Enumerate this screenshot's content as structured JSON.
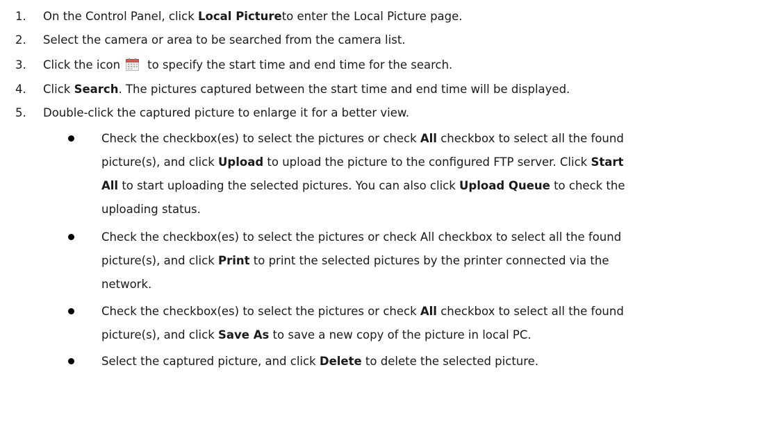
{
  "steps": [
    {
      "num": "1.",
      "pre": "On the Control Panel, click ",
      "bold": "Local Picture",
      "post": " to enter the Local Picture page."
    },
    {
      "num": "2.",
      "text": "Select the camera or area to be searched from the camera list."
    },
    {
      "num": "3.",
      "pre": "Click the icon",
      "post": "to specify the start time and end time for the search.",
      "icon": "calendar-icon"
    },
    {
      "num": "4.",
      "pre": "Click ",
      "bold": "Search",
      "post": ". The pictures captured between the start time and end time will be displayed."
    },
    {
      "num": "5.",
      "text": "Double-click the captured picture to enlarge it for a better view."
    }
  ],
  "bullets": [
    {
      "lines": [
        [
          {
            "t": "Check the checkbox(es) to select the pictures or check "
          },
          {
            "b": "All"
          },
          {
            "t": " checkbox to select all the found"
          }
        ],
        [
          {
            "t": "picture(s), and click "
          },
          {
            "b": "Upload"
          },
          {
            "t": " to upload the picture to the configured FTP server. Click "
          },
          {
            "b": "Start"
          }
        ],
        [
          {
            "b": "All"
          },
          {
            "t": " to start uploading the selected pictures. You can also click "
          },
          {
            "b": "Upload Queue"
          },
          {
            "t": " to check the"
          }
        ],
        [
          {
            "t": "uploading status."
          }
        ]
      ]
    },
    {
      "lines": [
        [
          {
            "t": "Check the checkbox(es) to select the pictures or check All checkbox to select all the found"
          }
        ],
        [
          {
            "t": "picture(s), and click "
          },
          {
            "b": "Print"
          },
          {
            "t": " to print the selected pictures by the printer connected via the"
          }
        ],
        [
          {
            "t": "network."
          }
        ]
      ]
    },
    {
      "lines": [
        [
          {
            "t": "Check the checkbox(es) to select the pictures or check "
          },
          {
            "b": "All"
          },
          {
            "t": " checkbox to select all the found"
          }
        ],
        [
          {
            "t": "picture(s), and click "
          },
          {
            "b": "Save As"
          },
          {
            "t": " to save a new copy of the picture in local PC."
          }
        ]
      ]
    },
    {
      "lines": [
        [
          {
            "t": "Select the captured picture, and click "
          },
          {
            "b": "Delete"
          },
          {
            "t": " to delete the selected picture."
          }
        ]
      ]
    }
  ],
  "colors": {
    "text": "#1a1a1a",
    "calendar_header": "#d9534f",
    "calendar_body": "#f3f3f3"
  }
}
